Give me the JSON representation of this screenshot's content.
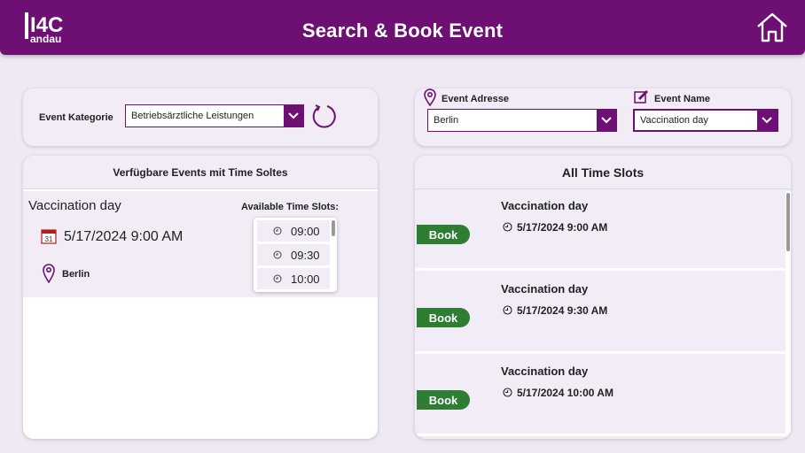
{
  "header": {
    "title": "Search & Book Event",
    "logo_top": "I4C",
    "logo_bottom": "andau",
    "brand_color": "#6d0f73"
  },
  "filters": {
    "kategorie_label": "Event Kategorie",
    "kategorie_value": "Betriebsärztliche Leistungen",
    "adresse_label": "Event Adresse",
    "adresse_value": "Berlin",
    "name_label": "Event Name",
    "name_value": "Vaccination day"
  },
  "left_panel": {
    "title": "Verfügbare Events mit Time Soltes",
    "event": {
      "name": "Vaccination day",
      "date": "5/17/2024 9:00 AM",
      "location": "Berlin",
      "slots_label": "Available Time Slots:",
      "slots": [
        "09:00",
        "09:30",
        "10:00"
      ]
    }
  },
  "right_panel": {
    "title": "All Time Slots",
    "book_label": "Book",
    "items": [
      {
        "name": "Vaccination day",
        "time": "5/17/2024 9:00 AM"
      },
      {
        "name": "Vaccination day",
        "time": "5/17/2024 9:30 AM"
      },
      {
        "name": "Vaccination day",
        "time": "5/17/2024 10:00 AM"
      }
    ]
  },
  "icons": {
    "home": "home-icon",
    "refresh": "refresh-icon",
    "location": "map-pin-icon",
    "edit": "edit-icon",
    "calendar": "calendar-icon",
    "clock": "clock-icon"
  },
  "colors": {
    "book_button": "#2e7d32",
    "background": "#efe9f3"
  }
}
